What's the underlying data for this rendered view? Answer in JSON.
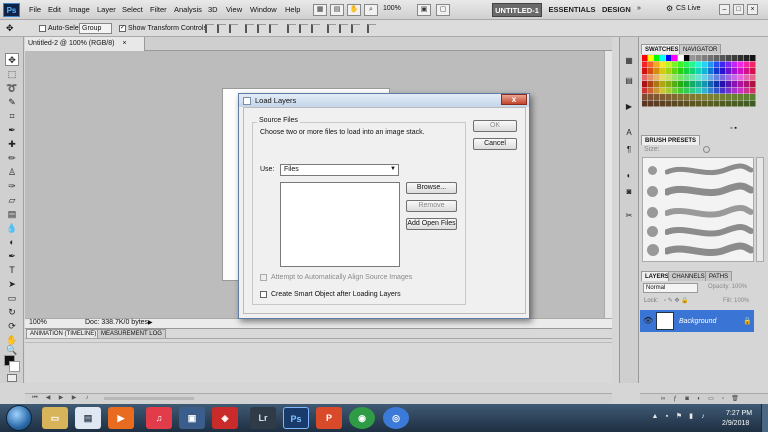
{
  "menubar": {
    "logo": "Ps",
    "items": [
      "File",
      "Edit",
      "Image",
      "Layer",
      "Select",
      "Filter",
      "Analysis",
      "3D",
      "View",
      "Window",
      "Help"
    ],
    "zoom": "100%",
    "workspace_tabs": [
      "UNTITLED-1",
      "ESSENTIALS",
      "DESIGN"
    ],
    "more": "»",
    "cs_live": "CS Live"
  },
  "options": {
    "auto_select_label": "Auto-Select:",
    "group_value": "Group",
    "show_transform_label": "Show Transform Controls"
  },
  "document": {
    "tab_title": "Untitled-2 @ 100% (RGB/8)",
    "status_zoom": "100%",
    "status_doc": "Doc: 338.7K/0 bytes"
  },
  "timeline": {
    "tabs": [
      "ANIMATION (TIMELINE)",
      "MEASUREMENT LOG"
    ]
  },
  "panels": {
    "swatch_tabs": [
      "SWATCHES",
      "NAVIGATOR"
    ],
    "brush_tab": "BRUSH PRESETS",
    "brush_size_label": "Size:",
    "layer_tabs": [
      "LAYERS",
      "CHANNELS",
      "PATHS"
    ],
    "blend_mode": "Normal",
    "opacity_label": "Opacity: 100%",
    "lock_label": "Lock:",
    "fill_label": "Fill: 100%",
    "layer_name": "Background"
  },
  "dialog": {
    "title": "Load Layers",
    "close": "x",
    "group_legend": "Source Files",
    "description": "Choose two or more files to load into an image stack.",
    "use_label": "Use:",
    "use_value": "Files",
    "browse": "Browse...",
    "remove": "Remove",
    "add_open": "Add Open Files",
    "ok": "OK",
    "cancel": "Cancel",
    "align_label": "Attempt to Automatically Align Source Images",
    "smart_object_label": "Create Smart Object after Loading Layers"
  },
  "taskbar": {
    "ps_label": "Ps",
    "lr_label": "Lr",
    "time": "7:27 PM",
    "date": "2/9/2018"
  },
  "colors": {
    "accent": "#3a75d5",
    "close_red": "#c3422a",
    "dialog_border": "#5d7da4"
  }
}
